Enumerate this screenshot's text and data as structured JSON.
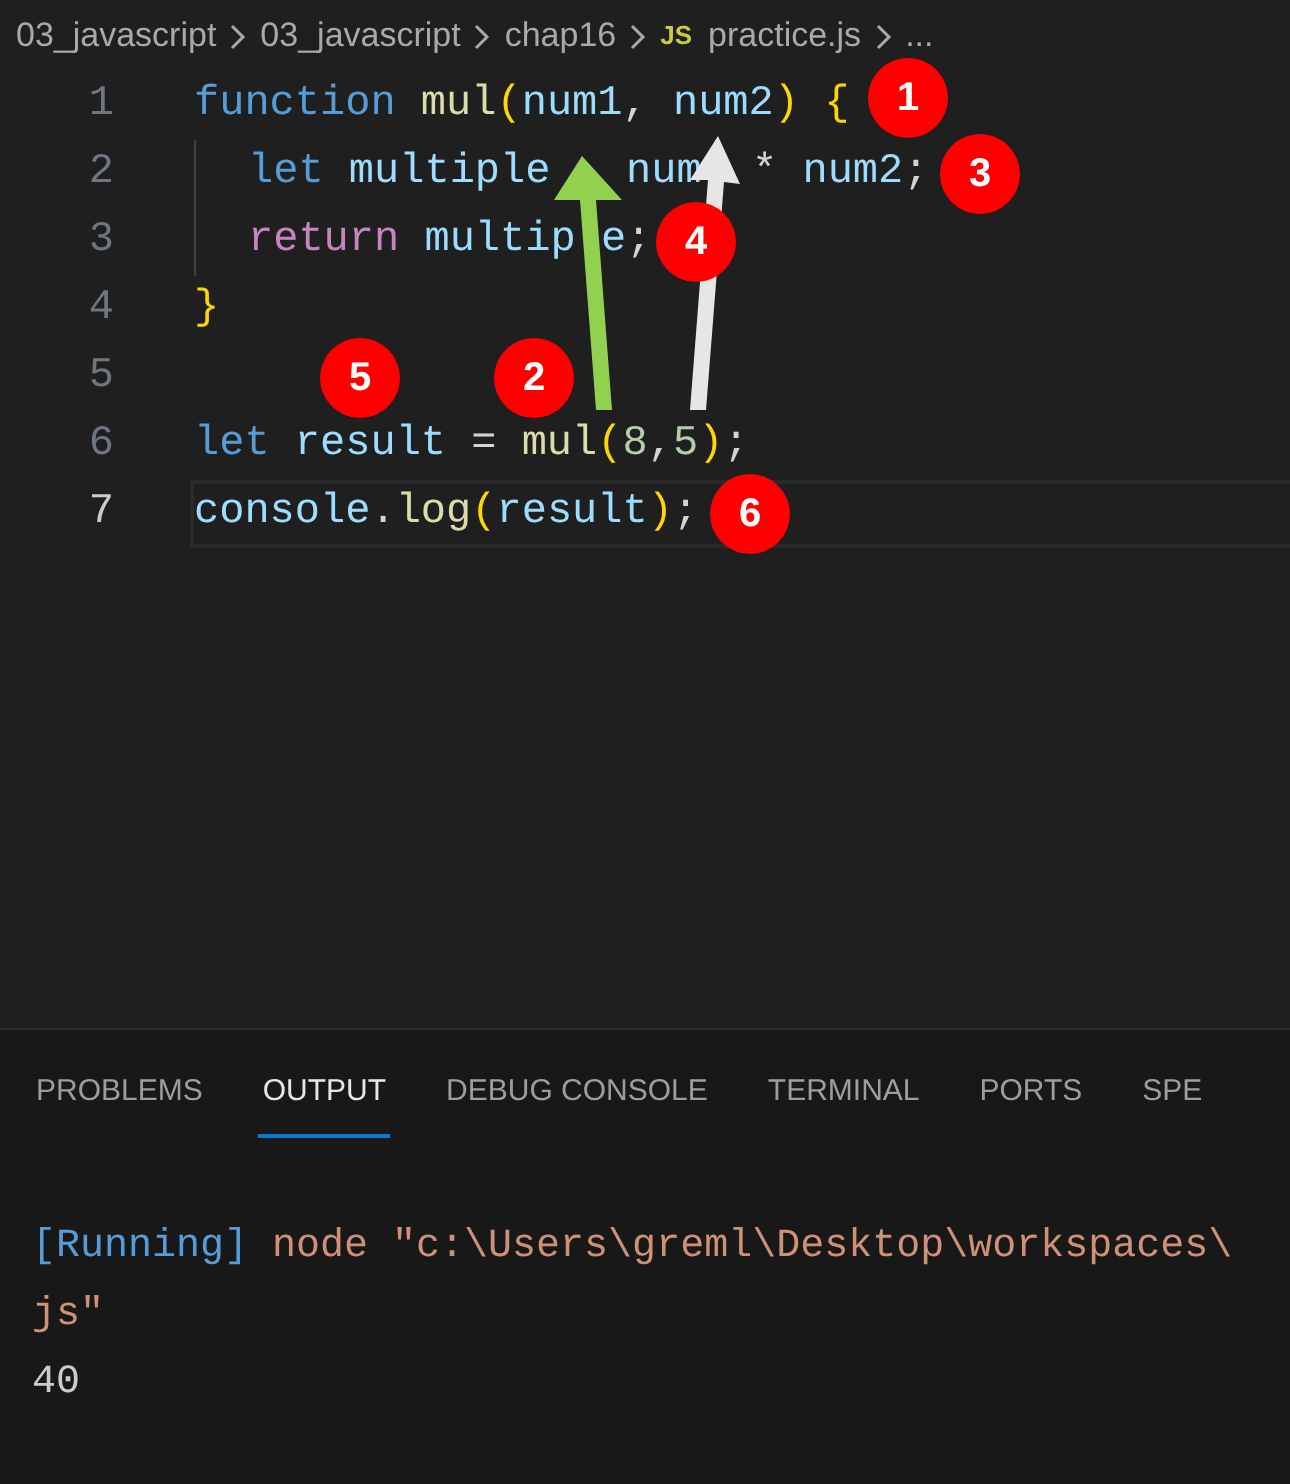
{
  "breadcrumb": [
    {
      "label": "03_javascript"
    },
    {
      "label": "03_javascript"
    },
    {
      "label": "chap16"
    },
    {
      "label": "practice.js",
      "file_badge": "JS"
    },
    {
      "label": "..."
    }
  ],
  "code_lines": [
    {
      "number": "1",
      "current": false,
      "indent": false,
      "tokens": [
        {
          "kind": "keyword",
          "text": "function"
        },
        {
          "kind": "function",
          "text": "mul",
          "space_before": true
        },
        {
          "kind": "bracket",
          "text": "("
        },
        {
          "kind": "variable",
          "text": "num1"
        },
        {
          "kind": "plain",
          "text": ","
        },
        {
          "kind": "variable",
          "text": "num2",
          "space_before": true
        },
        {
          "kind": "bracket",
          "text": ")"
        },
        {
          "kind": "bracket",
          "text": "{",
          "space_before": true
        }
      ]
    },
    {
      "number": "2",
      "current": false,
      "indent": true,
      "tokens": [
        {
          "kind": "keyword",
          "text": "let"
        },
        {
          "kind": "variable",
          "text": "multiple",
          "space_before": true
        },
        {
          "kind": "covered",
          "space_before": true
        },
        {
          "kind": "variable",
          "text": "num",
          "space_before": true
        },
        {
          "kind": "covered"
        },
        {
          "kind": "plain",
          "text": "*",
          "space_before": true
        },
        {
          "kind": "variable",
          "text": "num2",
          "space_before": true
        },
        {
          "kind": "plain",
          "text": ";"
        }
      ]
    },
    {
      "number": "3",
      "current": false,
      "indent": true,
      "tokens": [
        {
          "kind": "control",
          "text": "return"
        },
        {
          "kind": "variable",
          "text": "multip",
          "space_before": true
        },
        {
          "kind": "covered"
        },
        {
          "kind": "variable",
          "text": "e"
        },
        {
          "kind": "plain",
          "text": ";"
        }
      ]
    },
    {
      "number": "4",
      "current": false,
      "indent": false,
      "tokens": [
        {
          "kind": "bracket",
          "text": "}"
        }
      ]
    },
    {
      "number": "5",
      "current": false,
      "indent": false
    },
    {
      "number": "6",
      "current": false,
      "indent": false,
      "tokens": [
        {
          "kind": "keyword",
          "text": "let"
        },
        {
          "kind": "variable",
          "text": "result",
          "space_before": true
        },
        {
          "kind": "plain",
          "text": "=",
          "space_before": true
        },
        {
          "kind": "function",
          "text": "mul",
          "space_before": true
        },
        {
          "kind": "bracket",
          "text": "("
        },
        {
          "kind": "number",
          "text": "8"
        },
        {
          "kind": "plain",
          "text": ","
        },
        {
          "kind": "number",
          "text": "5"
        },
        {
          "kind": "bracket",
          "text": ")"
        },
        {
          "kind": "plain",
          "text": ";"
        }
      ]
    },
    {
      "number": "7",
      "current": true,
      "indent": false,
      "tokens": [
        {
          "kind": "variable",
          "text": "console"
        },
        {
          "kind": "plain",
          "text": "."
        },
        {
          "kind": "function",
          "text": "log"
        },
        {
          "kind": "bracket",
          "text": "("
        },
        {
          "kind": "variable",
          "text": "result"
        },
        {
          "kind": "bracket",
          "text": ")"
        },
        {
          "kind": "plain",
          "text": ";"
        }
      ]
    }
  ],
  "annotations": [
    {
      "label": "1"
    },
    {
      "label": "3"
    },
    {
      "label": "4"
    },
    {
      "label": "5"
    },
    {
      "label": "2"
    },
    {
      "label": "6"
    }
  ],
  "panel_tabs": [
    {
      "label": "PROBLEMS",
      "selected": false
    },
    {
      "label": "OUTPUT",
      "selected": true
    },
    {
      "label": "DEBUG CONSOLE",
      "selected": false
    },
    {
      "label": "TERMINAL",
      "selected": false
    },
    {
      "label": "PORTS",
      "selected": false
    },
    {
      "label": "SPE",
      "selected": false
    }
  ],
  "output": [
    {
      "kind": "command",
      "tag": "[Running]",
      "text": "node \"c:\\Users\\greml\\Desktop\\workspaces\\"
    },
    {
      "kind": "command_cont",
      "text": "js\""
    },
    {
      "kind": "result",
      "text": "40"
    }
  ]
}
